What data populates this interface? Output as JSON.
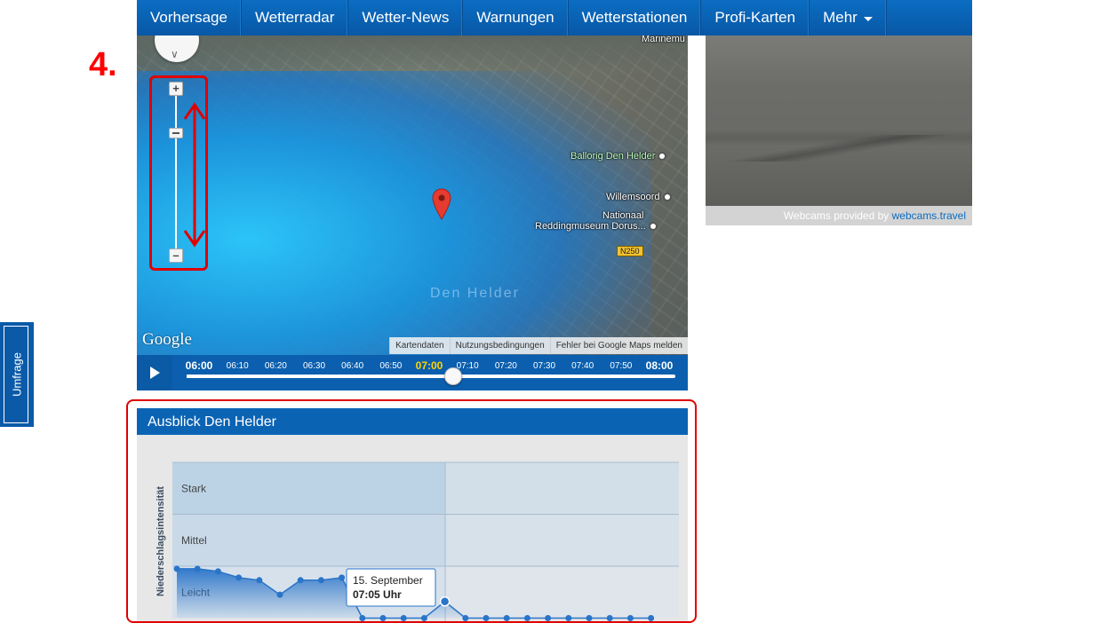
{
  "nav": {
    "items": [
      "Vorhersage",
      "Wetterradar",
      "Wetter-News",
      "Warnungen",
      "Wetterstationen",
      "Profi-Karten",
      "Mehr"
    ]
  },
  "step_label": "4.",
  "survey_tab": "Umfrage",
  "map": {
    "pois": {
      "ballorig": "Ballorig Den Helder",
      "willemsoord": "Willemsoord",
      "nationaal": "Nationaal",
      "reddingmuseum": "Reddingmuseum Dorus...",
      "marinemu": "Marinemu"
    },
    "city": "Den Helder",
    "road": "N250",
    "google": "Google",
    "footer": {
      "kartendaten": "Kartendaten",
      "nutzung": "Nutzungsbedingungen",
      "fehler": "Fehler bei Google Maps melden"
    },
    "zoom_level_fraction": 0.2
  },
  "timeline": {
    "ticks": [
      "06:00",
      "06:10",
      "06:20",
      "06:30",
      "06:40",
      "06:50",
      "07:00",
      "07:10",
      "07:20",
      "07:30",
      "07:40",
      "07:50",
      "08:00"
    ],
    "current": "07:00",
    "position_fraction": 0.545
  },
  "webcam": {
    "credit_prefix": "Webcams provided by",
    "credit_link": "webcams.travel"
  },
  "outlook": {
    "title": "Ausblick Den Helder",
    "ylabel": "Niederschlagsintensität",
    "bands": [
      "Stark",
      "Mittel",
      "Leicht"
    ],
    "tooltip": {
      "date": "15. September",
      "time": "07:05 Uhr"
    }
  },
  "chart_data": {
    "type": "area",
    "title": "Ausblick Den Helder",
    "ylabel": "Niederschlagsintensität",
    "y_categories": [
      "Leicht",
      "Mittel",
      "Stark"
    ],
    "ylim": [
      0,
      3
    ],
    "series": [
      {
        "values": [
          0.95,
          0.95,
          0.9,
          0.78,
          0.73,
          0.45,
          0.73,
          0.73,
          0.78,
          0,
          0,
          0,
          0,
          0.32,
          0,
          0,
          0,
          0,
          0,
          0,
          0,
          0,
          0,
          0
        ]
      }
    ],
    "highlighted_index": 13,
    "color": "#2a74c9"
  }
}
